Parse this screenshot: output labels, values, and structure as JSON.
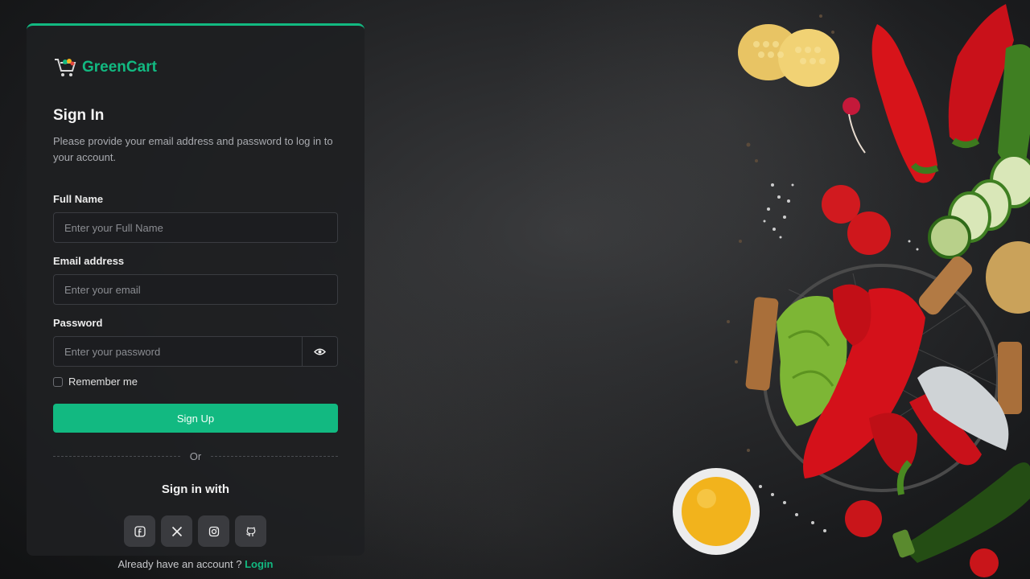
{
  "brand": {
    "name": "GreenCart",
    "accent": "#12b981"
  },
  "form": {
    "title": "Sign In",
    "subtitle": "Please provide your email address and password to log in to your account.",
    "full_name": {
      "label": "Full Name",
      "placeholder": "Enter your Full Name"
    },
    "email": {
      "label": "Email address",
      "placeholder": "Enter your email"
    },
    "password": {
      "label": "Password",
      "placeholder": "Enter your password"
    },
    "remember_label": "Remember me",
    "submit_label": "Sign Up",
    "divider_text": "Or",
    "social_heading": "Sign in with",
    "social_icons": [
      "facebook-icon",
      "x-icon",
      "instagram-icon",
      "github-icon"
    ]
  },
  "footer": {
    "prompt": "Already have an account ?",
    "login_label": "Login"
  }
}
